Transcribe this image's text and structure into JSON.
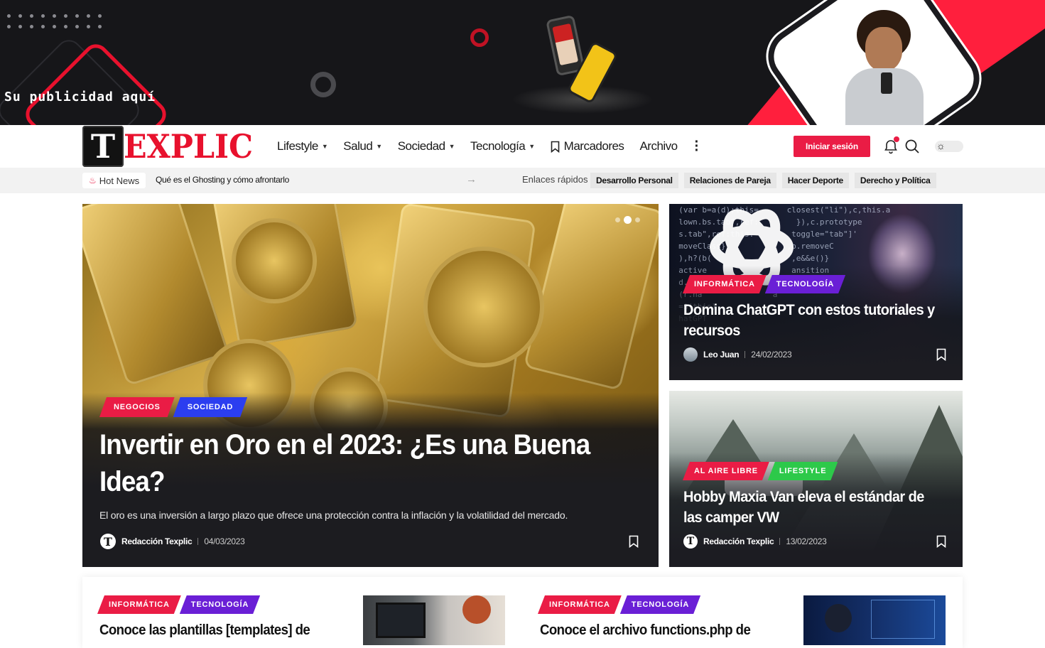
{
  "banner": {
    "text": "Su publicidad aquí"
  },
  "header": {
    "logo_letter": "T",
    "logo_word": "EXPLIC",
    "nav": [
      {
        "label": "Lifestyle",
        "has_dropdown": true
      },
      {
        "label": "Salud",
        "has_dropdown": true
      },
      {
        "label": "Sociedad",
        "has_dropdown": true
      },
      {
        "label": "Tecnología",
        "has_dropdown": true
      },
      {
        "label": "Marcadores",
        "has_dropdown": false
      },
      {
        "label": "Archivo",
        "has_dropdown": false
      }
    ],
    "login_label": "Iniciar sesión",
    "accent": "#ea1c45"
  },
  "ticker": {
    "hot_label": "Hot News",
    "headline": "Qué es el Ghosting y cómo afrontarlo",
    "quick_label": "Enlaces rápidos",
    "quick_links": [
      "Desarrollo Personal",
      "Relaciones de Pareja",
      "Hacer Deporte",
      "Derecho y Política"
    ]
  },
  "hero": {
    "tags": [
      "NEGOCIOS",
      "SOCIEDAD"
    ],
    "title": "Invertir en Oro en el 2023: ¿Es una Buena Idea?",
    "excerpt": "El oro es una inversión a largo plazo que ofrece una protección contra la inflación y la volatilidad del mercado.",
    "author_initial": "T",
    "author": "Redacción Texplic",
    "date": "04/03/2023"
  },
  "side_cards": [
    {
      "tags": [
        "INFORMÁTICA",
        "TECNOLOGÍA"
      ],
      "title": "Domina ChatGPT con estos tutoriales y recursos",
      "author": "Leo Juan",
      "date": "24/02/2023"
    },
    {
      "tags": [
        "AL AIRE LIBRE",
        "LIFESTYLE"
      ],
      "title": "Hobby Maxia Van eleva el estándar de las camper VW",
      "author_initial": "T",
      "author": "Redacción Texplic",
      "date": "13/02/2023"
    }
  ],
  "bottom_posts": [
    {
      "tags": [
        "INFORMÁTICA",
        "TECNOLOGÍA"
      ],
      "title": "Conoce las plantillas [templates] de"
    },
    {
      "tags": [
        "INFORMÁTICA",
        "TECNOLOGÍA"
      ],
      "title": "Conoce el archivo functions.php de"
    }
  ],
  "icons": [
    "fire-icon",
    "bookmark-icon",
    "bell-icon",
    "search-icon",
    "sun-icon",
    "chevron-down-icon",
    "more-vertical-icon",
    "arrow-right-icon"
  ]
}
